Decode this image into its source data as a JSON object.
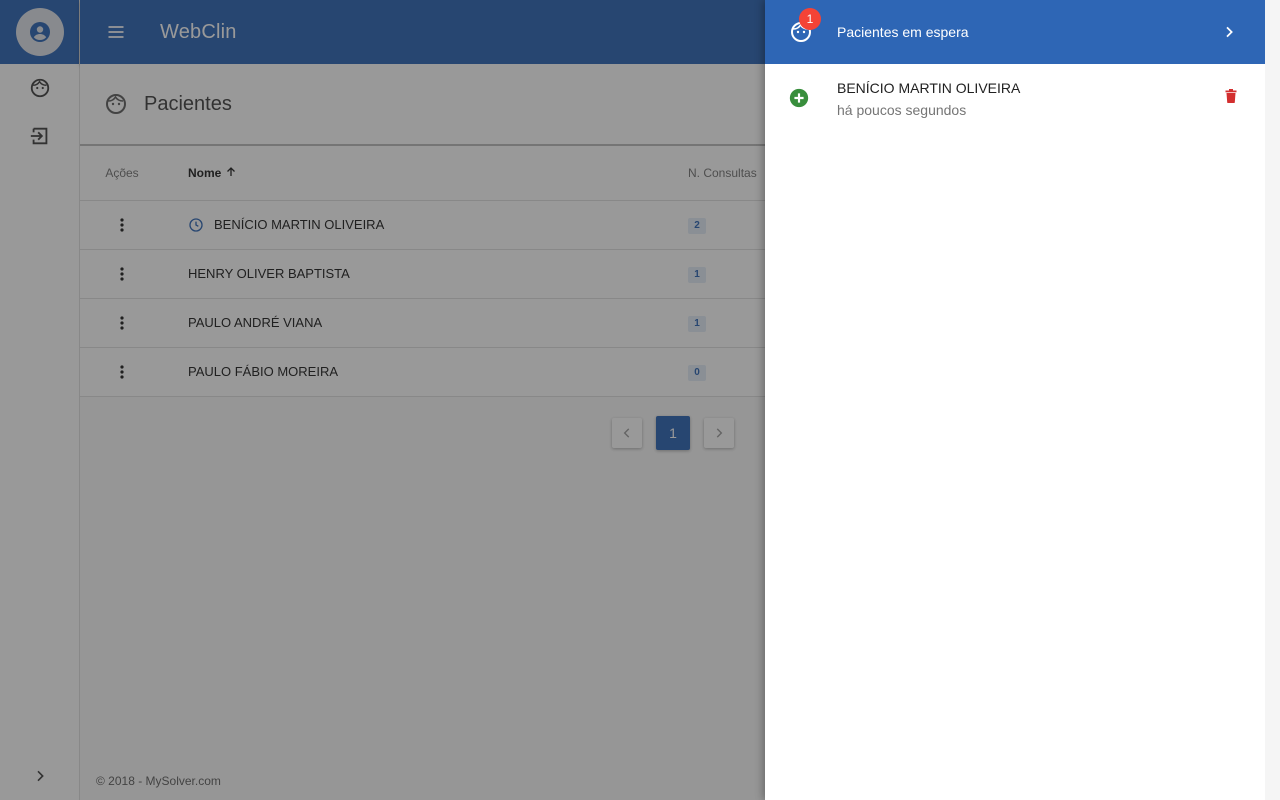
{
  "app": {
    "title": "WebClin",
    "footer": "© 2018 - MySolver.com"
  },
  "sidebar": {
    "items": [
      {
        "name": "patients",
        "icon": "face-icon"
      },
      {
        "name": "logout",
        "icon": "login-icon"
      }
    ]
  },
  "page": {
    "title": "Pacientes"
  },
  "table": {
    "headers": {
      "actions": "Ações",
      "name": "Nome",
      "count": "N. Consultas"
    },
    "rows": [
      {
        "name": "BENÍCIO MARTIN OLIVEIRA",
        "count": "2",
        "waiting": true
      },
      {
        "name": "HENRY OLIVER BAPTISTA",
        "count": "1",
        "waiting": false
      },
      {
        "name": "PAULO ANDRÉ VIANA",
        "count": "1",
        "waiting": false
      },
      {
        "name": "PAULO FÁBIO MOREIRA",
        "count": "0",
        "waiting": false
      }
    ]
  },
  "pagination": {
    "current": "1"
  },
  "drawer": {
    "title": "Pacientes em espera",
    "badge": "1",
    "items": [
      {
        "name": "BENÍCIO MARTIN OLIVEIRA",
        "time": "há poucos segundos"
      }
    ]
  },
  "colors": {
    "primary": "#2e66b5",
    "add": "#388e3c",
    "delete": "#d32f2f",
    "badge": "#f44336"
  }
}
